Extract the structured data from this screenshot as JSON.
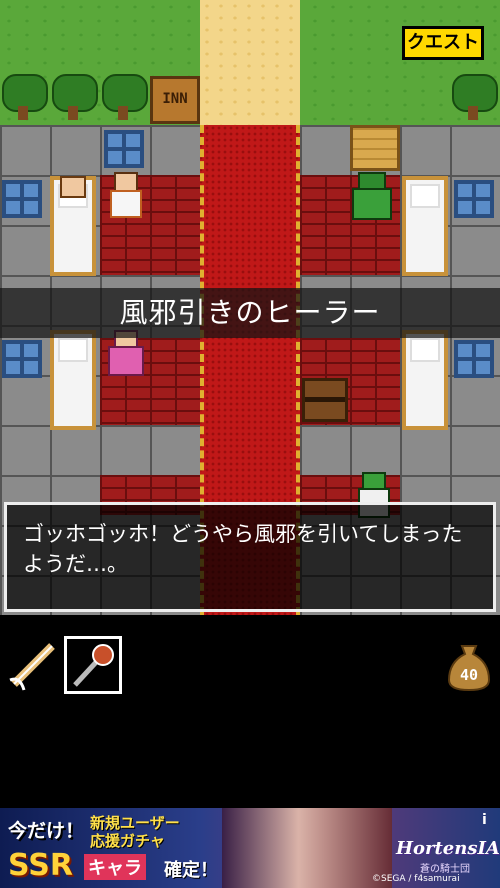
{
  "hud": {
    "quest_button": "クエスト"
  },
  "map": {
    "inn_sign": "INN"
  },
  "npc": {
    "name": "風邪引きのヒーラー"
  },
  "dialog": {
    "text": "ゴッホゴッホ！どうやら風邪を引いてしまったようだ…。"
  },
  "inventory": {
    "items": [
      {
        "icon": "sword-icon",
        "selected": false
      },
      {
        "icon": "mace-icon",
        "selected": true
      }
    ],
    "money": "40",
    "money_icon": "money-bag-icon"
  },
  "ad": {
    "line1": "今だけ！",
    "new_user": "新規ユーザー",
    "gacha": "応援ガチャ",
    "ssr": "SSR",
    "chara": "キャラ",
    "confirm": "確定！",
    "logo": "HortensIA",
    "logo_sub": "蒼の騎士団",
    "info": "i",
    "credit": "©SEGA / f4samurai"
  }
}
